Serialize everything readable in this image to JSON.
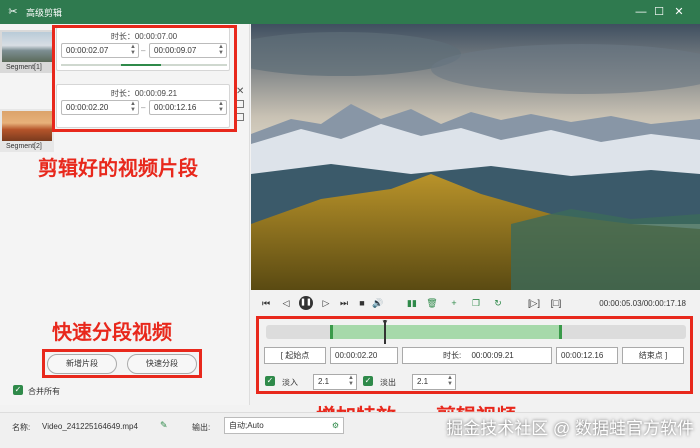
{
  "window": {
    "title": "高级剪辑",
    "app_icon": "scissors-icon",
    "buttons": [
      "minimize-icon",
      "maximize-icon",
      "close-icon"
    ]
  },
  "thumbnails": [
    {
      "label": "Segment[1]"
    },
    {
      "label": "Segment[2]"
    }
  ],
  "segments": [
    {
      "duration": "时长：00:00:07.00",
      "start": "00:00:02.07",
      "end": "00:00:09.07"
    },
    {
      "duration": "时长：00:00:09.21",
      "start": "00:00:02.20",
      "end": "00:00:12.16"
    }
  ],
  "annotations": {
    "clipped_segments": "剪辑好的视频片段",
    "quick_split": "快速分段视频",
    "effects": "增加特效",
    "edit_video": "剪辑视频"
  },
  "left_buttons": {
    "add_segment": "新增片段",
    "quick_split": "快速分段"
  },
  "merge_all": "合并所有",
  "player": {
    "timecode": "00:00:05.03/00:00:17.18"
  },
  "trim": {
    "start_label": "起始点",
    "start_value": "00:00:02.20",
    "duration_label": "时长:",
    "duration_value": "00:00:09.21",
    "end_value": "00:00:12.16",
    "end_label": "结束点"
  },
  "effects": {
    "fade_in_label": "淡入",
    "fade_in_value": "2.1",
    "fade_out_label": "淡出",
    "fade_out_value": "2.1"
  },
  "footer": {
    "name_label": "名称:",
    "file_name": "Video_241225164649.mp4",
    "output_label": "输出:",
    "output_value": "自动;Auto"
  },
  "watermark": "掘金技术社区 @ 数据蛙官方软件"
}
